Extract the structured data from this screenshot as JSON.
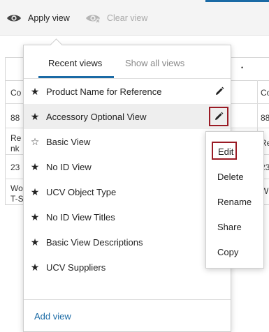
{
  "toolbar": {
    "apply_label": "Apply view",
    "clear_label": "Clear view"
  },
  "grid": {
    "left_cells": [
      "Co",
      "88",
      "Re",
      "nk",
      "23",
      "Wo",
      "T-S"
    ],
    "right_cells": [
      "Co",
      "88",
      "Re",
      "23",
      "W"
    ],
    "more_glyph": "•"
  },
  "dropdown": {
    "tabs": [
      {
        "label": "Recent views",
        "active": true
      },
      {
        "label": "Show all views",
        "active": false
      }
    ],
    "items": [
      {
        "label": "Product Name for Reference",
        "star": "filled"
      },
      {
        "label": "Accessory Optional View",
        "star": "filled"
      },
      {
        "label": "Basic View",
        "star": "hollow"
      },
      {
        "label": "No ID View",
        "star": "filled"
      },
      {
        "label": "UCV Object Type",
        "star": "filled"
      },
      {
        "label": "No ID View Titles",
        "star": "filled"
      },
      {
        "label": "Basic View Descriptions",
        "star": "filled"
      },
      {
        "label": "UCV Suppliers",
        "star": "filled"
      }
    ],
    "add_view_label": "Add view"
  },
  "context_menu": {
    "items": [
      "Edit",
      "Delete",
      "Rename",
      "Share",
      "Copy"
    ]
  },
  "colors": {
    "accent": "#1a6aa5",
    "highlight_box": "#9a1b25"
  }
}
